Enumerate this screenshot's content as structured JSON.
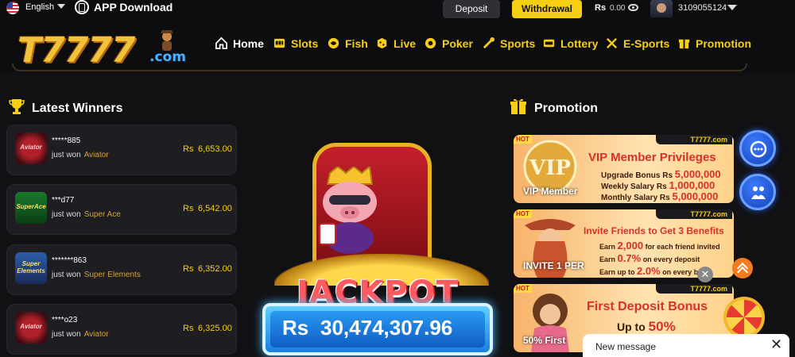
{
  "header": {
    "language": "English",
    "app_download": "APP Download",
    "deposit_label": "Deposit",
    "withdrawal_label": "Withdrawal",
    "balance_currency": "Rs",
    "balance_value": "0.00",
    "user_id": "3109055124",
    "logo_text": "T7777",
    "logo_suffix": ".com"
  },
  "nav": {
    "items": [
      {
        "label": "Home",
        "icon": "home-icon"
      },
      {
        "label": "Slots",
        "icon": "slots-icon"
      },
      {
        "label": "Fish",
        "icon": "fish-icon"
      },
      {
        "label": "Live",
        "icon": "live-icon"
      },
      {
        "label": "Poker",
        "icon": "poker-icon"
      },
      {
        "label": "Sports",
        "icon": "sports-icon"
      },
      {
        "label": "Lottery",
        "icon": "lottery-icon"
      },
      {
        "label": "E-Sports",
        "icon": "esports-icon"
      },
      {
        "label": "Promotion",
        "icon": "promotion-icon"
      }
    ]
  },
  "winners": {
    "title": "Latest Winners",
    "just_won": "just won",
    "currency": "Rs",
    "items": [
      {
        "user": "*****885",
        "game": "Aviator",
        "amount": "6,653.00",
        "thumb_label": "Aviator"
      },
      {
        "user": "***d77",
        "game": "Super Ace",
        "amount": "6,542.00",
        "thumb_label": "SuperAce"
      },
      {
        "user": "*******863",
        "game": "Super Elements",
        "amount": "6,352.00",
        "thumb_label": "Super Elements"
      },
      {
        "user": "****o23",
        "game": "Aviator",
        "amount": "6,325.00",
        "thumb_label": "Aviator"
      }
    ]
  },
  "jackpot": {
    "title": "JACKPOT",
    "currency": "Rs",
    "value": "30,474,307.96"
  },
  "promotion": {
    "title": "Promotion",
    "cards": [
      {
        "hot": "HOT",
        "brand": "T7777.com",
        "title": "VIP Member Privileges",
        "overlay": "VIP Member",
        "lines": [
          {
            "label": "Upgrade Bonus Rs",
            "value": "5,000,000"
          },
          {
            "label": "Weekly Salary Rs",
            "value": "1,000,000"
          },
          {
            "label": "Monthly Salary Rs",
            "value": "5,000,000"
          }
        ]
      },
      {
        "hot": "HOT",
        "brand": "T7777.com",
        "title": "Invite Friends to Get 3 Benefits",
        "overlay": "INVITE 1 PER",
        "lines": [
          {
            "label": "Earn",
            "value": "2,000",
            "suffix": "for each friend invited"
          },
          {
            "label": "Earn",
            "value": "0.7%",
            "suffix": "on every deposit"
          },
          {
            "label": "Earn up to",
            "value": "2.0%",
            "suffix": "on every bet"
          }
        ]
      },
      {
        "hot": "HOT",
        "brand": "T7777.com",
        "title": "First Deposit Bonus",
        "overlay": "50% First",
        "lines": [
          {
            "label": "Up to",
            "value": "50%"
          }
        ]
      }
    ]
  },
  "chat": {
    "new_message": "New message",
    "close": "✕"
  },
  "colors": {
    "accent_yellow": "#f6cf12",
    "background": "#111114",
    "card_bg": "#1d1d22",
    "jackpot_blue": "#1a7fe0"
  }
}
